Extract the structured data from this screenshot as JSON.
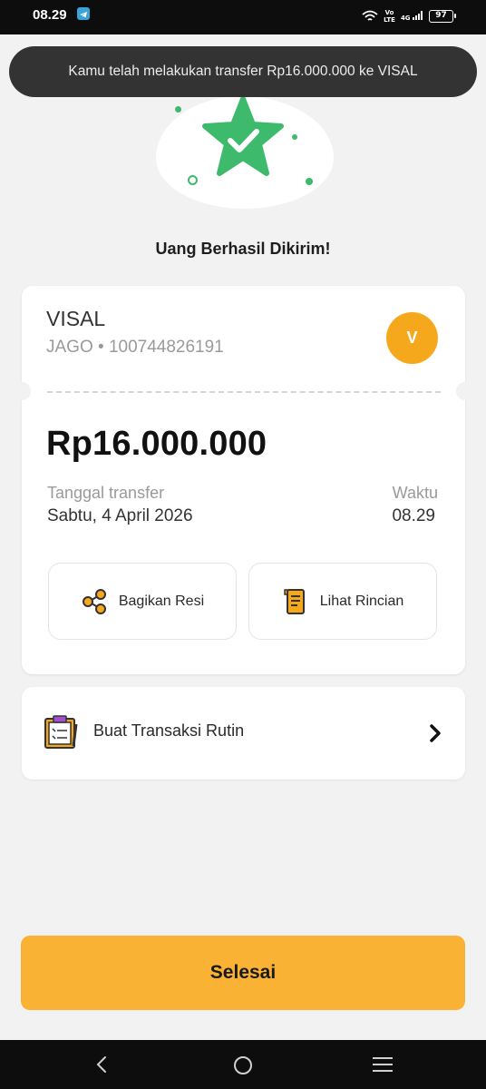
{
  "status_bar": {
    "time": "08.29",
    "volte_top": "Vo",
    "volte_bottom": "LTE",
    "network": "4G",
    "battery": "97",
    "icons": [
      "telegram-icon",
      "wifi-icon",
      "signal-icon",
      "battery-icon"
    ]
  },
  "toast": {
    "message": "Kamu telah melakukan transfer Rp16.000.000 ke VISAL"
  },
  "hero": {
    "title": "Uang Berhasil Dikirim!",
    "icon": "success-star-check-icon",
    "accent_color": "#3dba6b"
  },
  "transfer": {
    "recipient_name": "VISAL",
    "recipient_account": "JAGO • 100744826191",
    "avatar_initial": "V",
    "avatar_color": "#f6a81c",
    "amount": "Rp16.000.000",
    "date_label": "Tanggal transfer",
    "date_value": "Sabtu, 4 April 2026",
    "time_label": "Waktu",
    "time_value": "08.29"
  },
  "actions": {
    "share_label": "Bagikan Resi",
    "detail_label": "Lihat Rincian"
  },
  "routine": {
    "label": "Buat Transaksi Rutin"
  },
  "footer": {
    "finish_label": "Selesai",
    "button_color": "#f9b233"
  },
  "navigation": {
    "items": [
      "back-icon",
      "home-icon",
      "menu-icon"
    ]
  }
}
